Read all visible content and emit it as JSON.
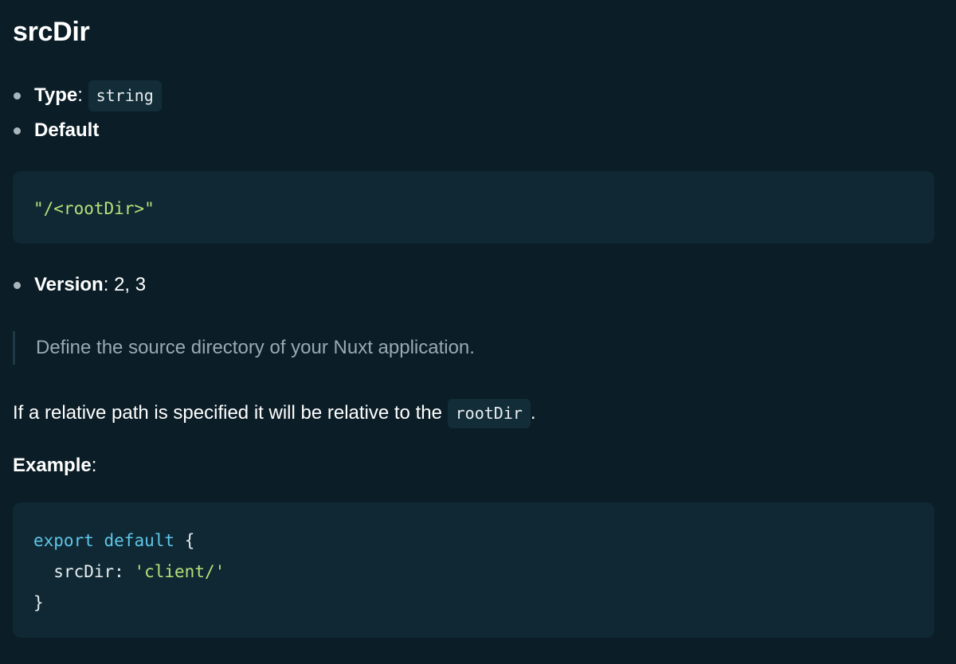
{
  "heading": "srcDir",
  "props": {
    "type_label": "Type",
    "type_value": "string",
    "default_label": "Default",
    "version_label": "Version",
    "version_value": "2, 3"
  },
  "default_code": "\"/<rootDir>\"",
  "description": "Define the source directory of your Nuxt application.",
  "paragraph": {
    "before": "If a relative path is specified it will be relative to the ",
    "code": "rootDir",
    "after": "."
  },
  "example_label": "Example",
  "example_code": {
    "line1_kw1": "export",
    "line1_kw2": "default",
    "line1_brace": "{",
    "line2_key": "srcDir:",
    "line2_val": "'client/'",
    "line3": "}"
  },
  "colors": {
    "background": "#0b1d26",
    "code_bg": "#0f2833",
    "keyword": "#5fc6e8",
    "string": "#b7e07a",
    "muted": "#9aa9b1"
  }
}
